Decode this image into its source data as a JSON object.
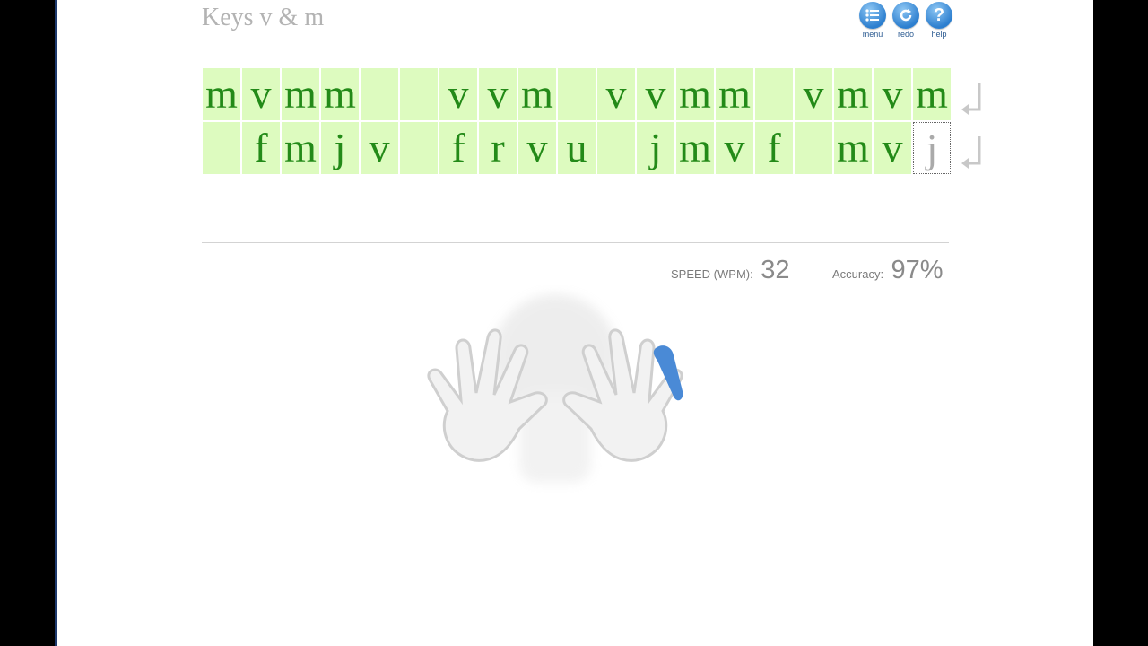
{
  "lesson": {
    "title": "Keys v & m"
  },
  "toolbar": {
    "menu": {
      "label": "menu",
      "icon": "menu-list-icon"
    },
    "redo": {
      "label": "redo",
      "icon": "redo-arrow-icon"
    },
    "help": {
      "label": "help",
      "icon": "question-mark-icon"
    }
  },
  "typing": {
    "row1": [
      "m",
      "v",
      "m",
      "m",
      " ",
      " ",
      "v",
      "v",
      "m",
      " ",
      "v",
      "v",
      "m",
      "m",
      " ",
      "v",
      "m",
      "v",
      "m"
    ],
    "row2": [
      " ",
      "f",
      "m",
      "j",
      "v",
      " ",
      "f",
      "r",
      "v",
      "u",
      " ",
      "j",
      "m",
      "v",
      "f",
      " ",
      "m",
      "v",
      "j"
    ],
    "current_key": "j",
    "enter_symbol": "↵"
  },
  "stats": {
    "speed_label": "SPEED (WPM):",
    "speed_value": "32",
    "accuracy_label": "Accuracy:",
    "accuracy_value": "97%"
  },
  "colors": {
    "typed_bg": "#ddfbbf",
    "typed_text": "#238a18",
    "highlight_finger": "#4a8ad6"
  }
}
